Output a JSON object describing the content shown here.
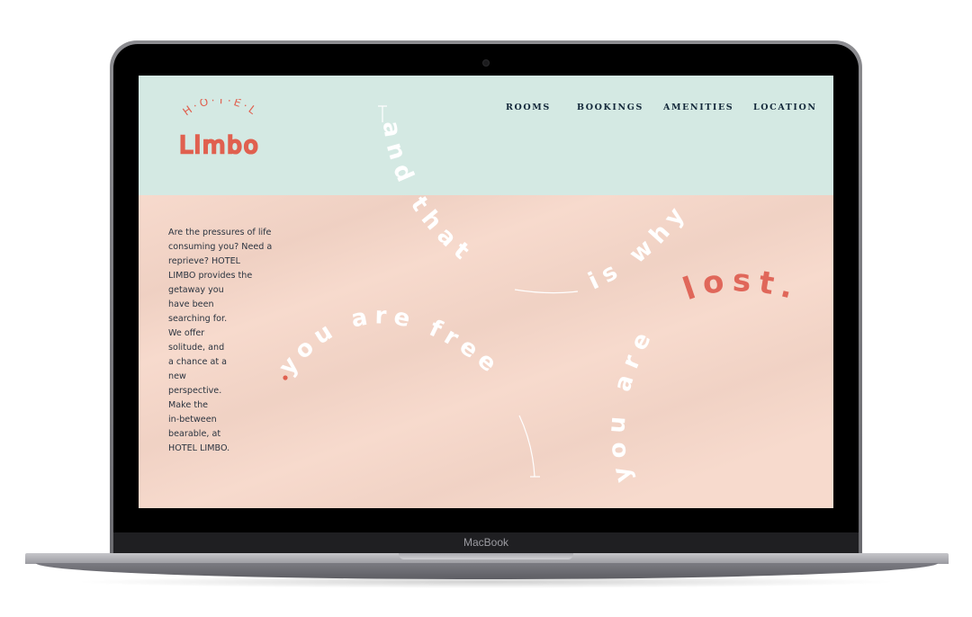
{
  "device": {
    "label": "MacBook"
  },
  "site": {
    "logo": {
      "top_text": "H·O·T·E·L",
      "main_text": "Limbo",
      "color": "#e0604f"
    },
    "nav": [
      {
        "label": "ROOMS"
      },
      {
        "label": "BOOKINGS"
      },
      {
        "label": "AMENITIES"
      },
      {
        "label": "LOCATION"
      }
    ],
    "intro_lines": [
      "Are the pressures of life",
      "consuming you? Need a",
      "reprieve? HOTEL",
      "LIMBO provides the",
      "getaway you",
      "have been",
      "searching for.",
      "We offer",
      "solitude, and",
      "a chance at a",
      "new",
      "perspective.",
      "Make the",
      "in-between",
      "bearable, at",
      "HOTEL LIMBO."
    ],
    "art_phrases": {
      "and_that": "and that",
      "you_are_free": "you are free",
      "is_why": "is why",
      "you_are": "you are",
      "lost": "lost."
    },
    "colors": {
      "header_bg": "#d4e9e3",
      "body_bg": "#f7dacd",
      "accent": "#e0604f",
      "nav_text": "#13283a",
      "art_text": "#ffffff"
    }
  }
}
